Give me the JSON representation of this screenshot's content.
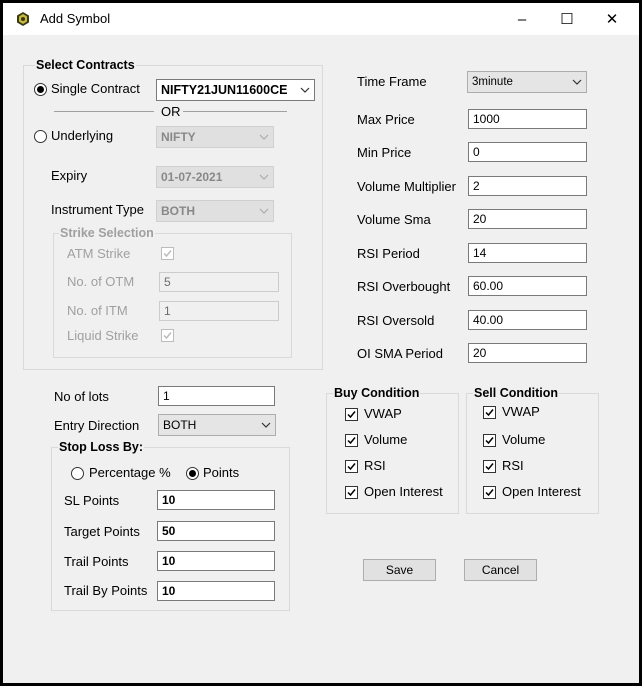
{
  "window": {
    "title": "Add Symbol",
    "minimize": "–",
    "maximize": "☐",
    "close": "✕"
  },
  "select_contracts": {
    "legend": "Select Contracts",
    "single_contract_label": "Single Contract",
    "single_contract_value": "NIFTY21JUN11600CE",
    "single_contract_checked": true,
    "or_label": "OR",
    "underlying_label": "Underlying",
    "underlying_value": "NIFTY",
    "underlying_checked": false,
    "expiry_label": "Expiry",
    "expiry_value": "01-07-2021",
    "instrument_type_label": "Instrument Type",
    "instrument_type_value": "BOTH",
    "strike_selection": {
      "legend": "Strike Selection",
      "atm_strike_label": "ATM Strike",
      "atm_strike_checked": true,
      "otm_label": "No. of OTM",
      "otm_value": "5",
      "itm_label": "No. of ITM",
      "itm_value": "1",
      "liquid_strike_label": "Liquid Strike",
      "liquid_strike_checked": true
    }
  },
  "params": {
    "time_frame_label": "Time Frame",
    "time_frame_value": "3minute",
    "max_price_label": "Max Price",
    "max_price_value": "1000",
    "min_price_label": "Min Price",
    "min_price_value": "0",
    "volume_multiplier_label": "Volume Multiplier",
    "volume_multiplier_value": "2",
    "volume_sma_label": "Volume Sma",
    "volume_sma_value": "20",
    "rsi_period_label": "RSI Period",
    "rsi_period_value": "14",
    "rsi_overbought_label": "RSI Overbought",
    "rsi_overbought_value": "60.00",
    "rsi_oversold_label": "RSI Oversold",
    "rsi_oversold_value": "40.00",
    "oi_sma_period_label": "OI SMA Period",
    "oi_sma_period_value": "20"
  },
  "orders": {
    "no_of_lots_label": "No of lots",
    "no_of_lots_value": "1",
    "entry_direction_label": "Entry Direction",
    "entry_direction_value": "BOTH"
  },
  "stop_loss": {
    "legend": "Stop Loss By:",
    "percentage_label": "Percentage %",
    "percentage_checked": false,
    "points_label": "Points",
    "points_checked": true,
    "sl_points_label": "SL Points",
    "sl_points_value": "10",
    "target_points_label": "Target Points",
    "target_points_value": "50",
    "trail_points_label": "Trail Points",
    "trail_points_value": "10",
    "trail_by_points_label": "Trail By Points",
    "trail_by_points_value": "10"
  },
  "buy_condition": {
    "legend": "Buy Condition",
    "items": [
      {
        "label": "VWAP",
        "checked": true
      },
      {
        "label": "Volume",
        "checked": true
      },
      {
        "label": "RSI",
        "checked": true
      },
      {
        "label": "Open Interest",
        "checked": true
      }
    ]
  },
  "sell_condition": {
    "legend": "Sell Condition",
    "items": [
      {
        "label": "VWAP",
        "checked": true
      },
      {
        "label": "Volume",
        "checked": true
      },
      {
        "label": "RSI",
        "checked": true
      },
      {
        "label": "Open Interest",
        "checked": true
      }
    ]
  },
  "actions": {
    "save_label": "Save",
    "cancel_label": "Cancel"
  }
}
